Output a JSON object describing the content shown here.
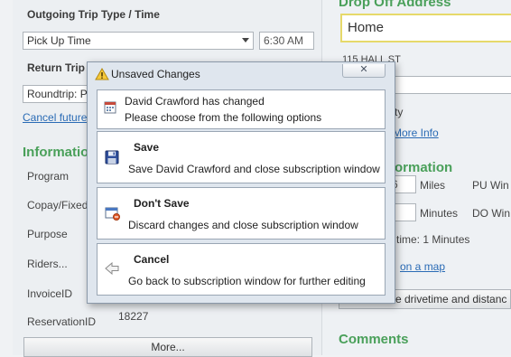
{
  "background": {
    "outgoing_trip_type_label": "Outgoing Trip Type / Time",
    "outgoing_type_value": "Pick Up Time",
    "outgoing_time_value": "6:30 AM",
    "return_trip_label": "Return Trip",
    "return_value": "Roundtrip: P",
    "cancel_future_link": "Cancel future",
    "information_heading": "Informatio",
    "fields": [
      {
        "label": "Program",
        "value": ""
      },
      {
        "label": "Copay/Fixed",
        "value": ""
      },
      {
        "label": "Purpose",
        "value": ""
      },
      {
        "label": "Riders...",
        "value": ""
      },
      {
        "label": "InvoiceID",
        "value": ""
      },
      {
        "label": "ReservationID",
        "value": "18227"
      }
    ],
    "more_button": "More...",
    "drop_off_heading": "Drop Off Address",
    "drop_off_input": "Home",
    "drop_off_address": "115 HALL ST",
    "city_fragment": "ty",
    "more_info_link": "More Info",
    "right_info_heading": "ormation",
    "miles_value": "6",
    "miles_label": "Miles",
    "pu_win_label": "PU Win",
    "minutes_label": "Minutes",
    "do_win_label": "DO Win",
    "time_line": "time: 1 Minutes",
    "on_a_map_link": "on a map",
    "drivetime_button": "e drivetime and distanc",
    "comments_heading": "Comments"
  },
  "dialog": {
    "title": "Unsaved Changes",
    "info_line1": "David Crawford has changed",
    "info_line2": "Please choose from the following options",
    "options": [
      {
        "title": "Save",
        "description": "Save David Crawford and close subscription window"
      },
      {
        "title": "Don't Save",
        "description": "Discard changes and close subscription window"
      },
      {
        "title": "Cancel",
        "description": "Go back to subscription window for further editing"
      }
    ]
  }
}
